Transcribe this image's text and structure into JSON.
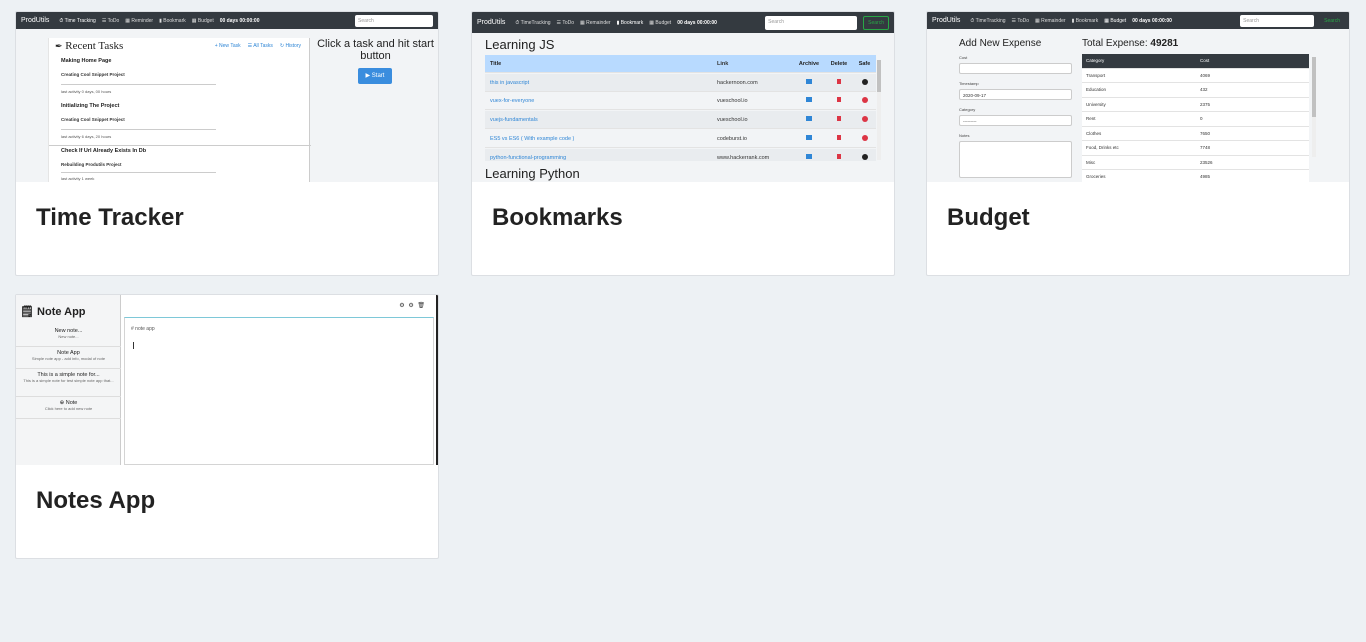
{
  "cards": [
    {
      "title": "Time Tracker",
      "thumb": {
        "nav": {
          "brand": "ProdUtils",
          "links": [
            "⏱ Time Tracking",
            "☰ ToDo",
            "▦ Reminder",
            "▮ Bookmark",
            "▦ Budget"
          ],
          "time": "00 days 00:00:00",
          "search": "Search"
        },
        "heading": "Recent Tasks",
        "actions": [
          "+ New Task",
          "☰ All Tasks",
          "↻ History"
        ],
        "tasks": [
          {
            "title": "Making Home Page",
            "project": "Creating Cool Snippet Project",
            "meta": "last activity 0 days, 00 hours"
          },
          {
            "title": "Initializing The Project",
            "project": "Creating Cool Snippet Project",
            "meta": "last activity 6 days, 20 hours"
          },
          {
            "title": "Check If Url Already Exists In Db",
            "project": "Rebuilding Produtils Project",
            "meta": "last activity 1 week"
          }
        ],
        "prompt": "Click a task and hit start button",
        "start": "▶ Start"
      }
    },
    {
      "title": "Bookmarks",
      "thumb": {
        "nav": {
          "brand": "ProdUtils",
          "links": [
            "⏱ TimeTracking",
            "☰ ToDo",
            "▦ Remainder",
            "▮ Bookmark",
            "▦ Budget"
          ],
          "time": "00 days 00:00:00",
          "search": "Search",
          "button": "Search"
        },
        "section1": "Learning JS",
        "section2": "Learning Python",
        "headers": [
          "Title",
          "Link",
          "Archive",
          "Delete",
          "Safe"
        ],
        "rows": [
          {
            "title": "this in javascript",
            "link": "hackernoon.com",
            "safe": "ok"
          },
          {
            "title": "vuex-for-everyone",
            "link": "vueschool.io",
            "safe": "x"
          },
          {
            "title": "vuejs-fundamentals",
            "link": "vueschool.io",
            "safe": "x"
          },
          {
            "title": "ES5 vs ES6 ( With example code )",
            "link": "codeburst.io",
            "safe": "x"
          },
          {
            "title": "python-functional-programming",
            "link": "www.hackerrank.com",
            "safe": "ok"
          }
        ]
      }
    },
    {
      "title": "Budget",
      "thumb": {
        "nav": {
          "brand": "ProdUtils",
          "links": [
            "⏱ TimeTracking",
            "☰ ToDo",
            "▦ Remainder",
            "▮ Bookmark",
            "▦ Budget"
          ],
          "time": "00 days 00:00:00",
          "search": "Search",
          "button": "Search"
        },
        "form_title": "Add New Expense",
        "labels": [
          "Cost",
          "Timestamp",
          "Category",
          "Notes"
        ],
        "timestamp_value": "2020-09-17",
        "category_value": "---------",
        "total_label": "Total Expense:",
        "total_value": "49281",
        "headers": [
          "Category",
          "Cost"
        ],
        "rows": [
          [
            "Transport",
            "4069"
          ],
          [
            "Education",
            "432"
          ],
          [
            "University",
            "2375"
          ],
          [
            "Rent",
            "0"
          ],
          [
            "Clothes",
            "7650"
          ],
          [
            "Food, Drinks etc",
            "7748"
          ],
          [
            "Misc",
            "23526"
          ],
          [
            "Groceries",
            "4985"
          ]
        ]
      }
    },
    {
      "title": "Notes App",
      "thumb": {
        "brand": "Note App",
        "items": [
          {
            "title": "New note...",
            "sub": "New note..."
          },
          {
            "title": "Note App",
            "sub": "Simple note app - add info, modal of note"
          },
          {
            "title": "This is a simple note for...",
            "sub": "This is a simple note for test simple note app that..."
          },
          {
            "title": "⊕ Note",
            "sub": "Click here to add new note"
          }
        ],
        "editor_heading": "# note app",
        "tools": "⚙ ⚙ 🗑"
      }
    }
  ]
}
